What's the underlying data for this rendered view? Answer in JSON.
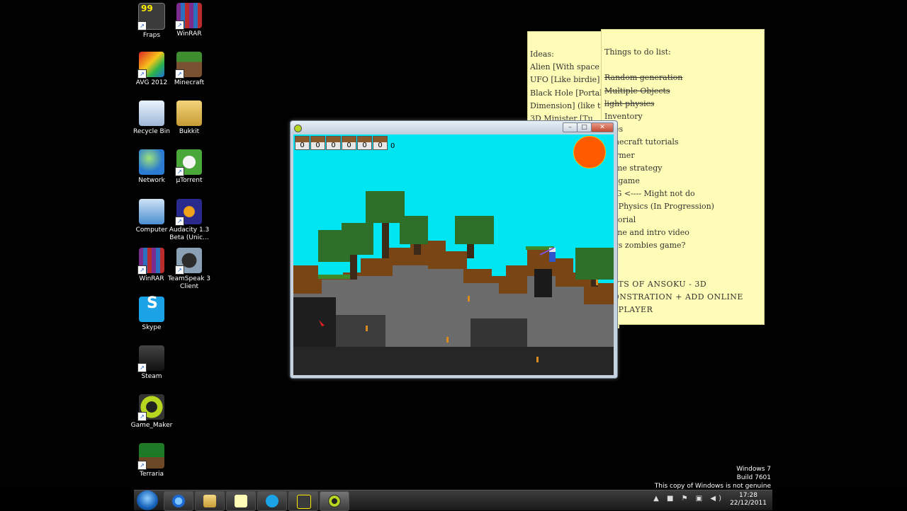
{
  "desktop_icons": [
    {
      "label": "Fraps",
      "icon": "fraps-icon"
    },
    {
      "label": "WinRAR",
      "icon": "winrar-icon"
    },
    {
      "label": "AVG 2012",
      "icon": "avg-icon"
    },
    {
      "label": "Minecraft",
      "icon": "minecraft-icon"
    },
    {
      "label": "Recycle Bin",
      "icon": "recycle-bin-icon"
    },
    {
      "label": "Bukkit",
      "icon": "folder-icon"
    },
    {
      "label": "Network",
      "icon": "network-icon"
    },
    {
      "label": "µTorrent",
      "icon": "utorrent-icon"
    },
    {
      "label": "Computer",
      "icon": "computer-icon"
    },
    {
      "label": "Audacity 1.3 Beta (Unic...",
      "icon": "audacity-icon"
    },
    {
      "label": "WinRAR",
      "icon": "winrar-icon"
    },
    {
      "label": "TeamSpeak 3 Client",
      "icon": "teamspeak-icon"
    },
    {
      "label": "Skype",
      "icon": "skype-icon"
    },
    {
      "label": "Steam",
      "icon": "steam-icon"
    },
    {
      "label": "Game_Maker",
      "icon": "game-maker-icon"
    },
    {
      "label": "Terraria",
      "icon": "terraria-icon"
    }
  ],
  "notes": {
    "ideas": {
      "lines": [
        "Ideas:",
        "Alien [With space g",
        "UFO [Like birdie]",
        "Black Hole [Portal",
        "Dimension]   (like ti",
        "3D Minister [Tu"
      ]
    },
    "todo": {
      "lines": [
        {
          "text": "Things to do list:",
          "strike": false
        },
        {
          "text": "",
          "strike": false
        },
        {
          "text": "Random generation",
          "strike": true
        },
        {
          "text": "Multiple Objects",
          "strike": true
        },
        {
          "text": "light physics",
          "strike": true
        },
        {
          "text": "Inventory",
          "strike": false
        },
        {
          "text": "mies",
          "strike": false
        },
        {
          "text": "minecraft tutorials",
          "strike": false
        },
        {
          "text": "tformer",
          "strike": false
        },
        {
          "text": "l time strategy",
          "strike": false
        },
        {
          "text": "zle game",
          "strike": false
        },
        {
          "text": "RPG <---- Might not do",
          "strike": false
        },
        {
          "text": "ter Physics (In Progression)",
          "strike": false
        },
        {
          "text": "Tutorial",
          "strike": false
        },
        {
          "text": "scene and intro video",
          "strike": false
        },
        {
          "text": "ts vs zombies game?",
          "strike": false
        },
        {
          "text": "ng",
          "strike": false
        },
        {
          "text": "",
          "strike": false
        },
        {
          "text": "GHTS OF ANSOKU - 3D",
          "strike": false
        },
        {
          "text": "MONSTRATION + ADD ONLINE",
          "strike": false
        },
        {
          "text": "LTIPLAYER",
          "strike": false
        }
      ]
    }
  },
  "game_window": {
    "hud_slots": [
      "0",
      "0",
      "0",
      "0",
      "0",
      "0"
    ],
    "hud_count": "0"
  },
  "watermark": {
    "line1": "Windows 7",
    "line2": "Build 7601",
    "line3": "This copy of Windows is not genuine"
  },
  "taskbar": {
    "pinned": [
      "internet-explorer-icon",
      "windows-explorer-icon",
      "sticky-notes-icon",
      "skype-icon",
      "fraps-icon",
      "game-maker-icon"
    ],
    "time": "17:28",
    "date": "22/12/2011"
  },
  "colors": {
    "sky": "#00e5f2",
    "sun": "#ff5a00",
    "note": "#fefcb6"
  }
}
